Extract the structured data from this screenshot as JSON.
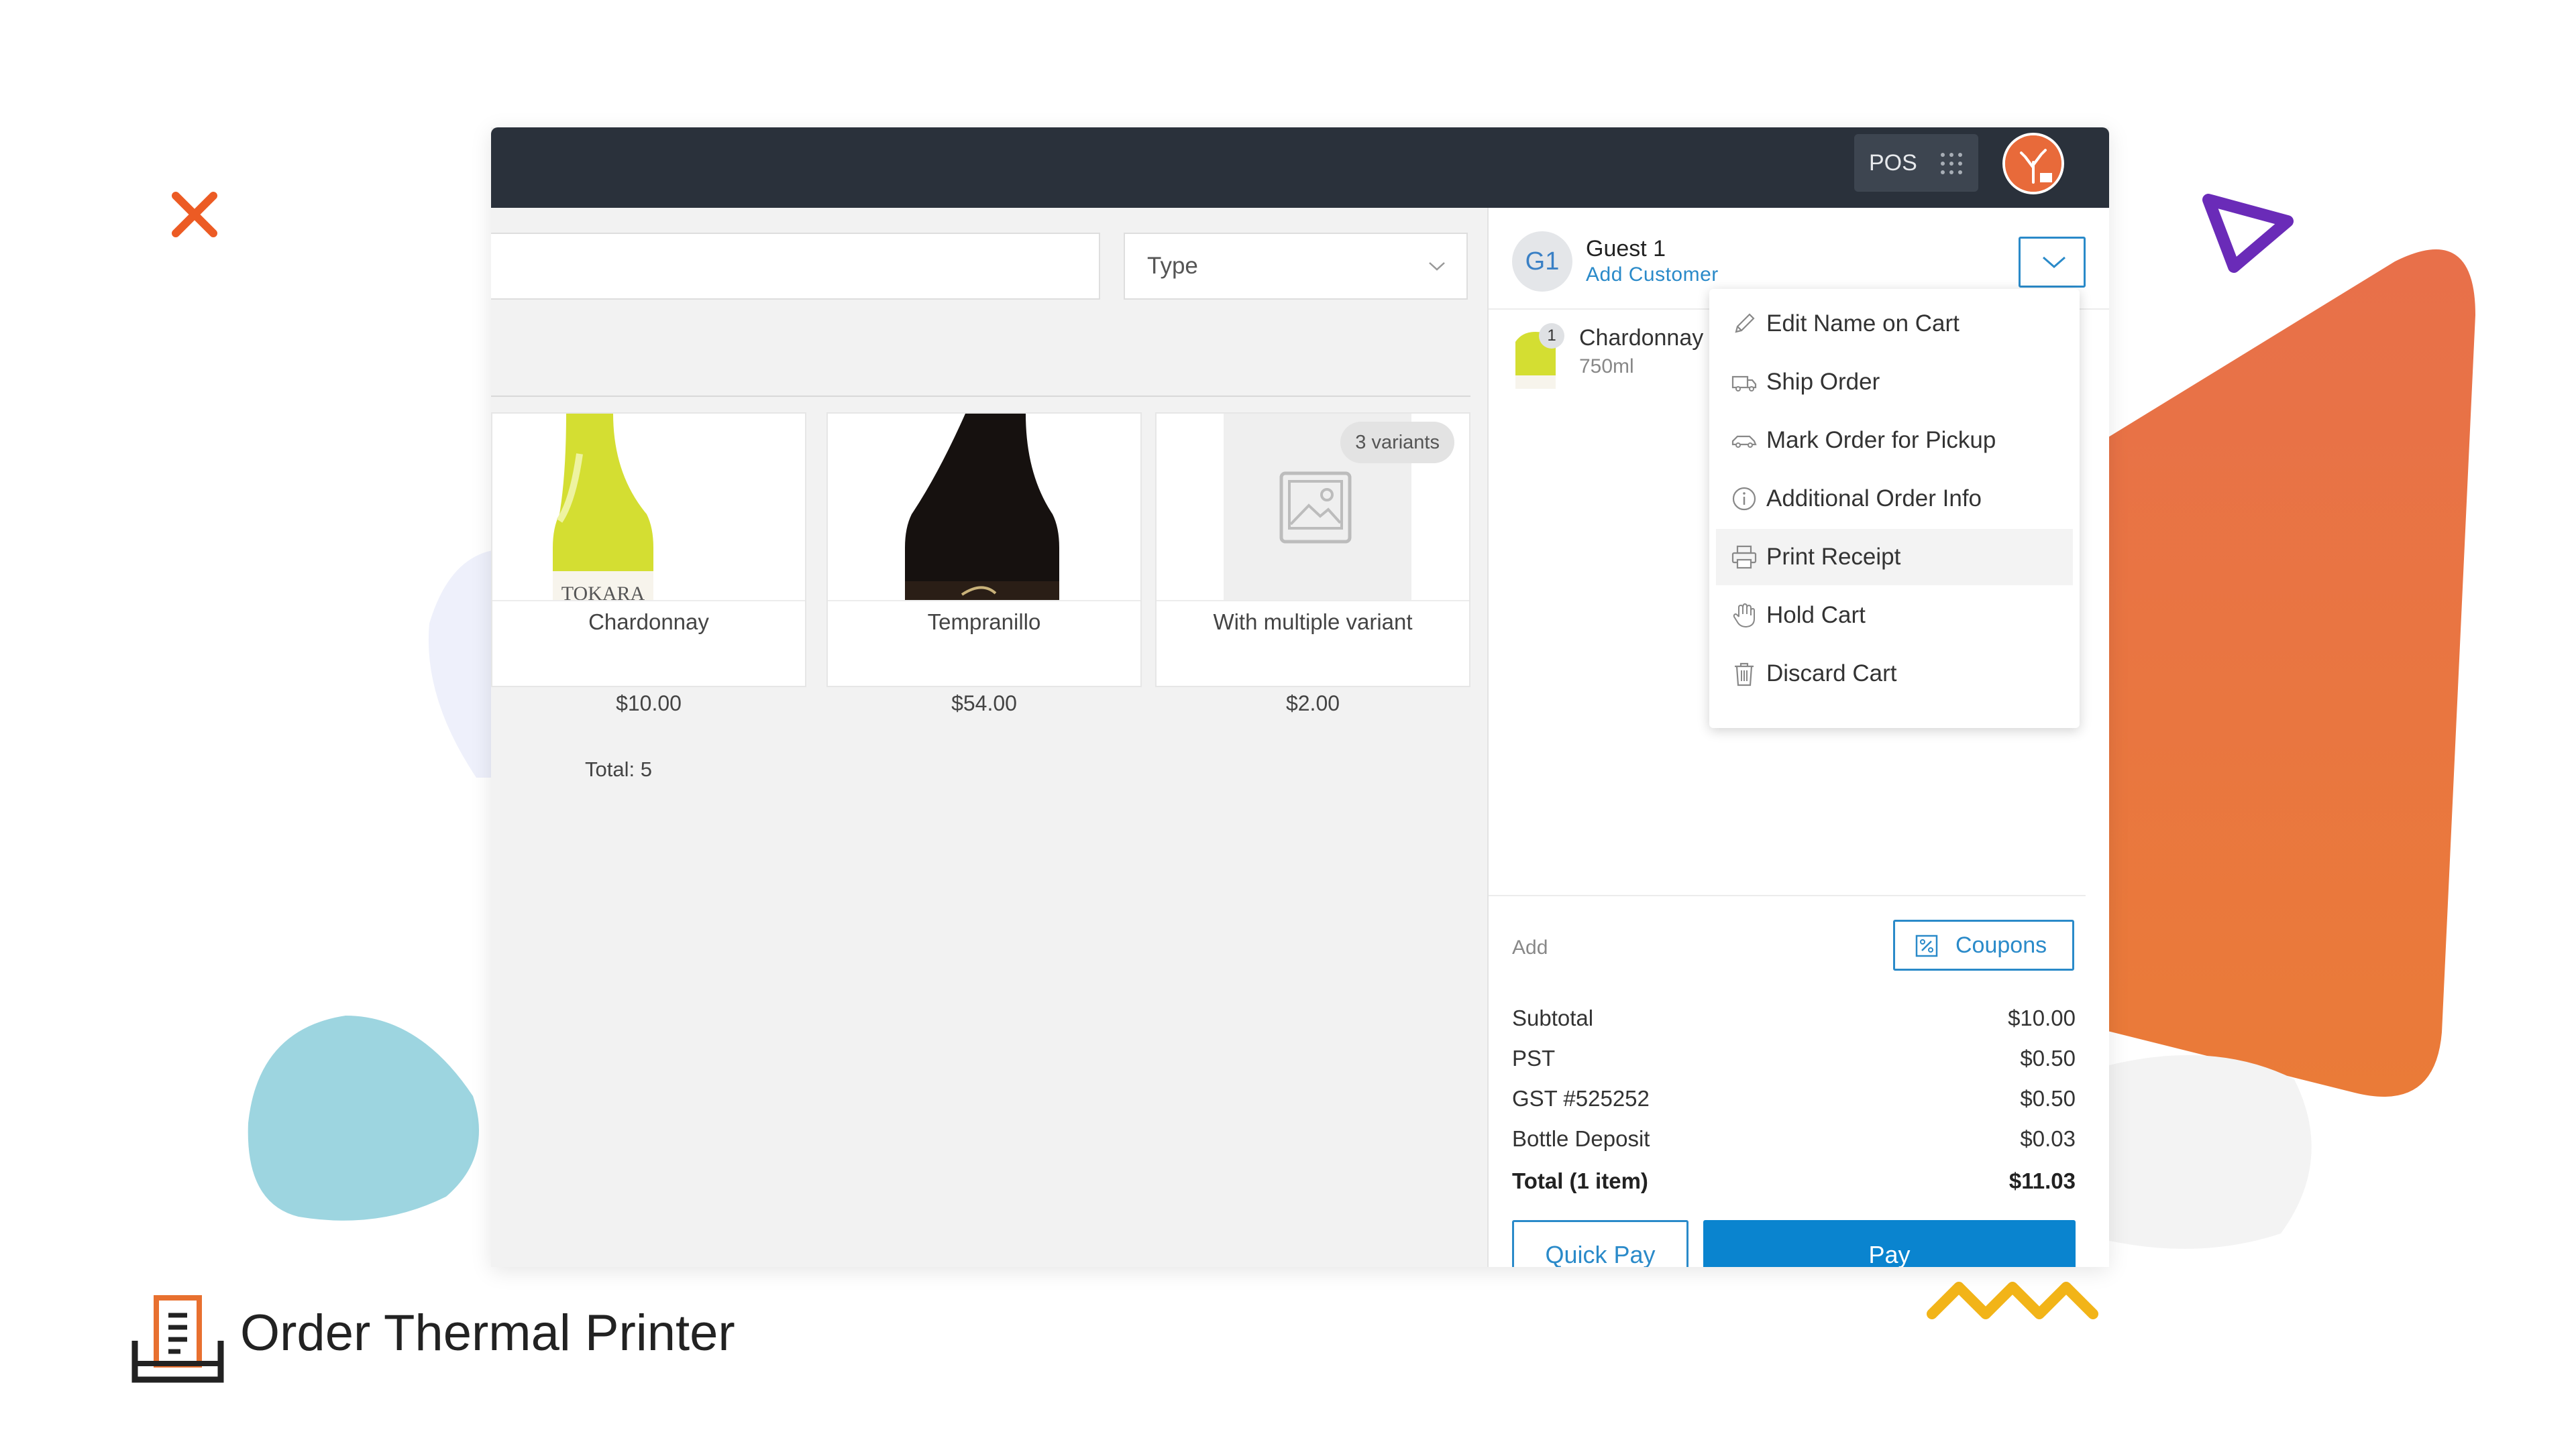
{
  "colors": {
    "accent": "#2a8ac9",
    "pay": "#0a84cf",
    "topbar": "#2a313b",
    "brand_orange": "#e8702f"
  },
  "topbar": {
    "app_label": "POS"
  },
  "filters": {
    "search_placeholder": "",
    "type_label": "Type"
  },
  "products": [
    {
      "name": "Chardonnay",
      "price": "$10.00"
    },
    {
      "name": "Tempranillo",
      "price": "$54.00"
    },
    {
      "name": "With multiple variant",
      "price": "$2.00",
      "badge": "3 variants"
    }
  ],
  "products_total": "Total: 5",
  "cart": {
    "guest_initials": "G1",
    "guest_name": "Guest 1",
    "add_customer": "Add Customer",
    "items": [
      {
        "name": "Chardonnay",
        "size": "750ml",
        "qty": "1"
      }
    ],
    "add_label": "Add",
    "coupons_label": "Coupons",
    "summary": [
      {
        "label": "Subtotal",
        "value": "$10.00"
      },
      {
        "label": "PST",
        "value": "$0.50"
      },
      {
        "label": "GST #525252",
        "value": "$0.50"
      },
      {
        "label": "Bottle Deposit",
        "value": "$0.03"
      },
      {
        "label": "Total (1 item)",
        "value": "$11.03"
      }
    ],
    "quick_pay_label": "Quick Pay",
    "pay_label": "Pay"
  },
  "menu": {
    "items": [
      {
        "label": "Edit Name on Cart",
        "icon": "pencil-icon"
      },
      {
        "label": "Ship Order",
        "icon": "truck-icon"
      },
      {
        "label": "Mark Order for Pickup",
        "icon": "car-icon"
      },
      {
        "label": "Additional Order Info",
        "icon": "info-icon"
      },
      {
        "label": "Print Receipt",
        "icon": "printer-icon"
      },
      {
        "label": "Hold Cart",
        "icon": "hand-icon"
      },
      {
        "label": "Discard Cart",
        "icon": "trash-icon"
      }
    ]
  },
  "brand": {
    "title": "Order Thermal Printer"
  }
}
